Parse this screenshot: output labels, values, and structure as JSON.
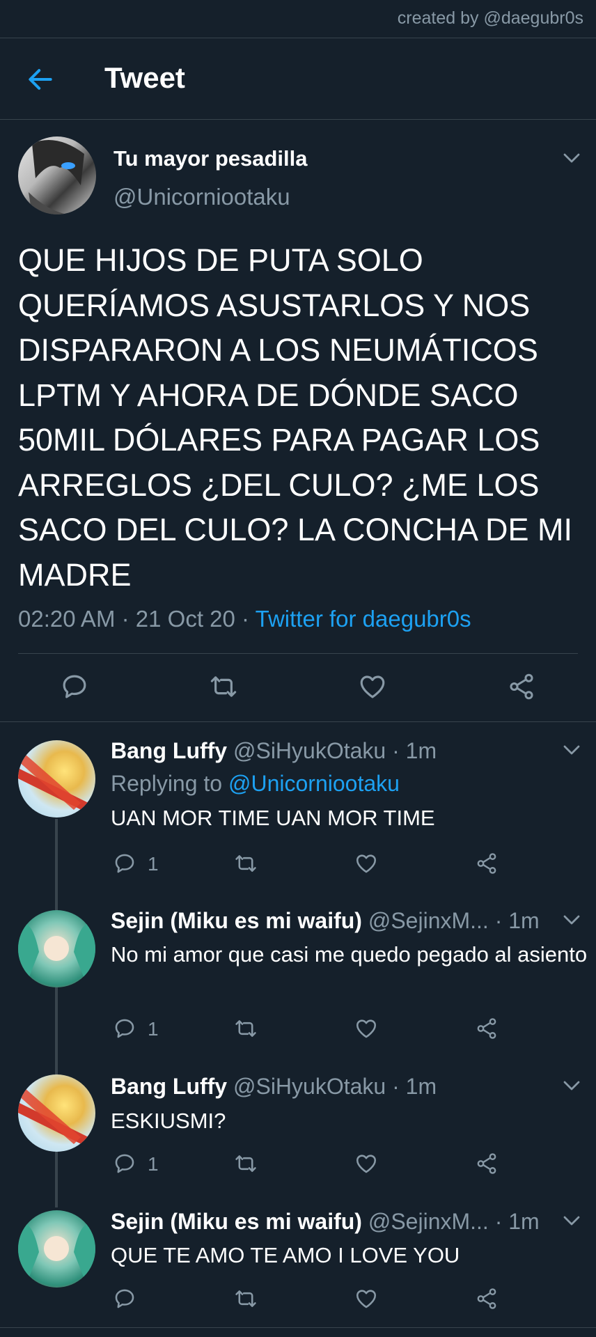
{
  "credit": "created by @daegubr0s",
  "header": {
    "title": "Tweet"
  },
  "tweet": {
    "author_name": "Tu mayor pesadilla",
    "author_handle": "@Unicorniootaku",
    "text": "QUE HIJOS DE PUTA SOLO QUERÍAMOS ASUSTARLOS Y NOS DISPARARON A LOS NEUMÁTICOS LPTM Y AHORA DE DÓNDE SACO 50MIL DÓLARES PARA PAGAR LOS ARREGLOS ¿DEL CULO? ¿ME LOS SACO DEL CULO? LA CONCHA DE MI MADRE",
    "time": "02:20 AM",
    "date": "21 Oct 20",
    "separator": "·",
    "client": "Twitter for daegubr0s"
  },
  "replies": [
    {
      "name": "Bang Luffy",
      "handle": "@SiHyukOtaku",
      "time": "· 1m",
      "replying_label": "Replying to",
      "replying_handle": "@Unicorniootaku",
      "text": "UAN MOR TIME UAN MOR TIME",
      "reply_count": "1"
    },
    {
      "name": "Sejin (Miku es mi waifu)",
      "handle": "@SejinxM...",
      "time": "· 1m",
      "text": "No mi amor que casi me quedo pegado al asiento",
      "reply_count": "1"
    },
    {
      "name": "Bang Luffy",
      "handle": "@SiHyukOtaku",
      "time": "· 1m",
      "text": "ESKIUSMI?",
      "reply_count": "1"
    },
    {
      "name": "Sejin (Miku es mi waifu)",
      "handle": "@SejinxM...",
      "time": "· 1m",
      "text": "QUE TE AMO TE AMO I LOVE YOU",
      "reply_count": ""
    }
  ],
  "colors": {
    "background": "#15202b",
    "accent": "#1da1f2",
    "secondary_text": "#8899a6",
    "divider": "#38444d"
  },
  "icons": {
    "back": "arrow-left-icon",
    "more": "chevron-down-icon",
    "reply": "speech-bubble-icon",
    "retweet": "retweet-icon",
    "like": "heart-icon",
    "share": "share-icon"
  }
}
